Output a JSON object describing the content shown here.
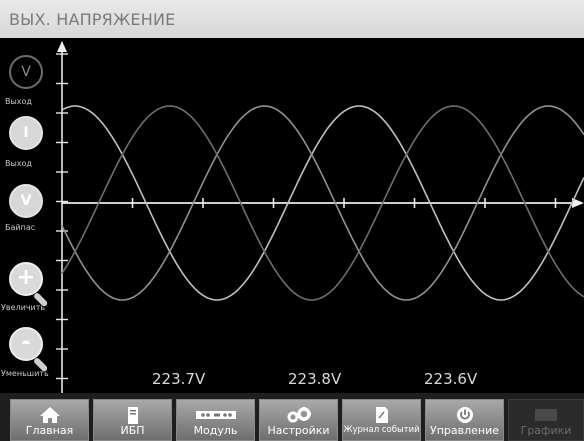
{
  "header": {
    "title": "ВЫХ. НАПРЯЖЕНИЕ"
  },
  "sidebar": {
    "buttons": [
      {
        "glyph": "V",
        "label": "Выход"
      },
      {
        "glyph": "I",
        "label": "Выход"
      },
      {
        "glyph": "V",
        "label": "Байпас"
      }
    ],
    "zoom_in": {
      "glyph": "+",
      "label": "Увеличить"
    },
    "zoom_out": {
      "glyph": "-",
      "label": "Уменьшить"
    }
  },
  "readings": [
    "223.7V",
    "223.8V",
    "223.6V"
  ],
  "toolbar": {
    "tabs": [
      {
        "label": "Главная",
        "icon": "home-icon"
      },
      {
        "label": "ИБП",
        "icon": "ups-icon"
      },
      {
        "label": "Модуль",
        "icon": "module-icon"
      },
      {
        "label": "Настройки",
        "icon": "gears-icon"
      },
      {
        "label": "Журнал событий",
        "icon": "event-log-icon"
      },
      {
        "label": "Управление",
        "icon": "power-icon"
      },
      {
        "label": "Графики",
        "icon": "chart-icon"
      }
    ]
  },
  "waveforms": {
    "colors": [
      "#bfbfbf",
      "#909090",
      "#6d6d6d"
    ],
    "phase_offsets_deg": [
      0,
      120,
      240
    ]
  }
}
